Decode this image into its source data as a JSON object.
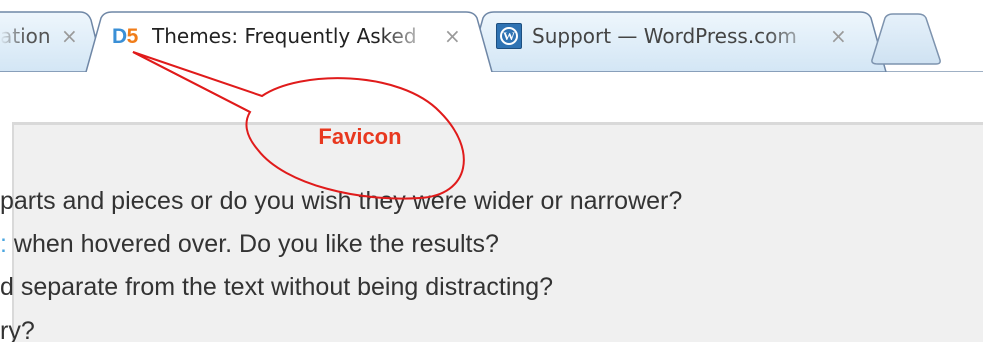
{
  "window": {
    "tabs": [
      {
        "title": "ation",
        "close_glyph": "×",
        "active": false,
        "favicon": null
      },
      {
        "title": "Themes: Frequently Asked",
        "close_glyph": "×",
        "active": true,
        "favicon": "D5"
      },
      {
        "title": "Support — WordPress.com",
        "close_glyph": "×",
        "active": false,
        "favicon": "wordpress-icon"
      }
    ],
    "new_tab": {
      "icon": "new-tab-icon"
    }
  },
  "favicon_d5": {
    "d": "D",
    "five": "5"
  },
  "callout": {
    "label": "Favicon"
  },
  "content": {
    "lines": [
      "parts and pieces or do you wish they were wider or narrower?",
      " when hovered over. Do you like the results?",
      "d separate from the text without being distracting?",
      "ry?"
    ]
  },
  "colors": {
    "callout_red": "#e01b1b",
    "callout_label": "#e8381f",
    "d5_blue": "#3a8fd6",
    "d5_orange": "#f07d1a",
    "tab_active_bg": "#ffffff",
    "tab_inactive_bg": "#dcecf8",
    "tab_border": "#6f87a6",
    "text": "#333333",
    "content_bg": "#f0f0f0"
  }
}
